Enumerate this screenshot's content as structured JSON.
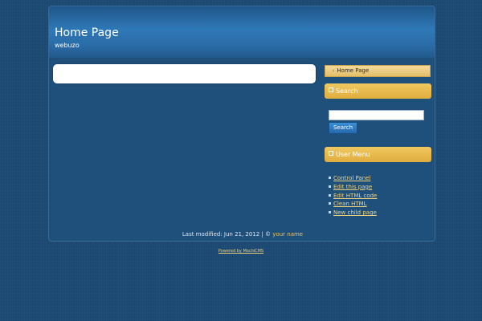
{
  "header": {
    "title": "Home Page",
    "subtitle": "webuzo"
  },
  "navigation": {
    "current_item": "Home Page"
  },
  "search_panel": {
    "title": "Search",
    "input_value": "",
    "button_label": "Search"
  },
  "user_menu": {
    "title": "User Menu",
    "items": [
      {
        "label": "Control Panel"
      },
      {
        "label": "Edit this page"
      },
      {
        "label": "Edit HTML code"
      },
      {
        "label": "Clean HTML"
      },
      {
        "label": "New child page"
      }
    ]
  },
  "footer": {
    "last_modified": "Last modified: Jun 21, 2012 | © ",
    "name_link": "your name",
    "powered_by": "Powered by MochiCMS"
  },
  "colors": {
    "background": "#1d4a73",
    "header_gradient": "#2f78b7",
    "panel_gold": "#e0ad3e",
    "link_gold": "#f2d37c"
  }
}
